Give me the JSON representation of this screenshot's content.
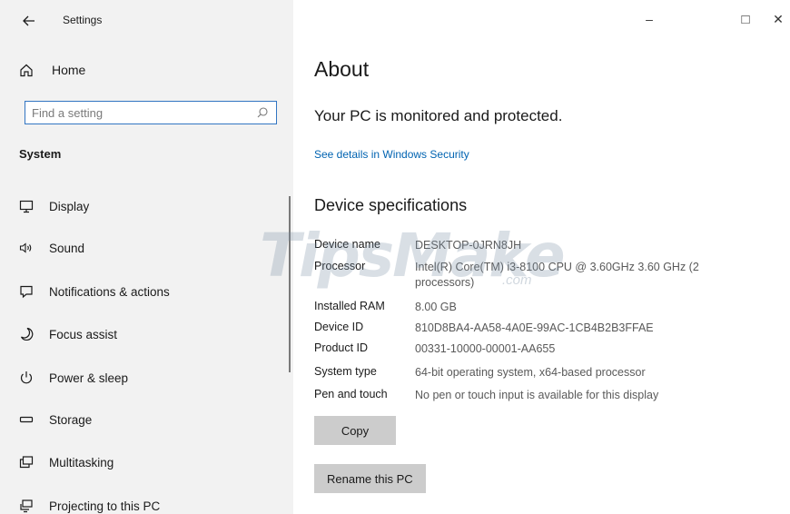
{
  "window": {
    "title": "Settings",
    "minimize_symbol": "–",
    "maximize_symbol": "□",
    "close_symbol": "✕"
  },
  "sidebar": {
    "home_label": "Home",
    "search_placeholder": "Find a setting",
    "section_label": "System",
    "items": [
      {
        "label": "Display",
        "icon": "monitor-icon"
      },
      {
        "label": "Sound",
        "icon": "speaker-icon"
      },
      {
        "label": "Notifications & actions",
        "icon": "notification-icon"
      },
      {
        "label": "Focus assist",
        "icon": "moon-icon"
      },
      {
        "label": "Power & sleep",
        "icon": "power-icon"
      },
      {
        "label": "Storage",
        "icon": "storage-icon"
      },
      {
        "label": "Multitasking",
        "icon": "multitasking-icon"
      },
      {
        "label": "Projecting to this PC",
        "icon": "projecting-icon"
      }
    ]
  },
  "main": {
    "title": "About",
    "protection_status": "Your PC is monitored and protected.",
    "security_link": "See details in Windows Security",
    "specs_title": "Device specifications",
    "specs": [
      {
        "key": "Device name",
        "value": "DESKTOP-0JRN8JH"
      },
      {
        "key": "Processor",
        "value": "Intel(R) Core(TM) i3-8100 CPU @ 3.60GHz   3.60 GHz (2 processors)"
      },
      {
        "key": "Installed RAM",
        "value": "8.00 GB"
      },
      {
        "key": "Device ID",
        "value": "810D8BA4-AA58-4A0E-99AC-1CB4B2B3FFAE"
      },
      {
        "key": "Product ID",
        "value": "00331-10000-00001-AA655"
      },
      {
        "key": "System type",
        "value": "64-bit operating system, x64-based processor"
      },
      {
        "key": "Pen and touch",
        "value": "No pen or touch input is available for this display"
      }
    ],
    "copy_button": "Copy",
    "rename_button": "Rename this PC"
  },
  "watermark": {
    "text": "TipsMake",
    "suffix": ".com"
  },
  "colors": {
    "accent": "#0063b1",
    "search_border": "#3275c2",
    "sidebar_bg": "#f2f2f2",
    "button_bg": "#cccccc"
  }
}
